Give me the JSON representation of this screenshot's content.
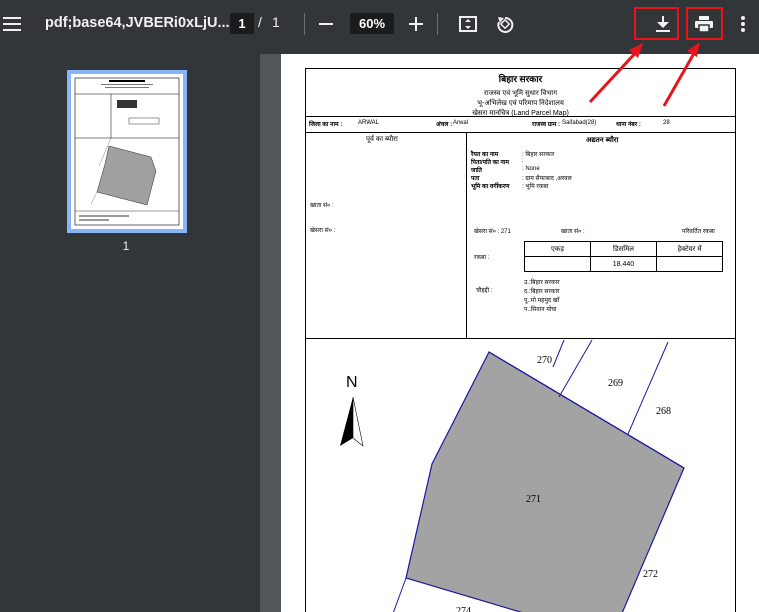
{
  "toolbar": {
    "title": "pdf;base64,JVBERi0xLjU...",
    "page_current": "1",
    "page_sep": "/",
    "page_total": "1",
    "zoom": "60%",
    "icons": [
      "menu-icon",
      "zoom-out-icon",
      "zoom-in-icon",
      "fit-page-icon",
      "rotate-icon",
      "download-icon",
      "print-icon",
      "more-vert-icon"
    ],
    "highlight_color": "#e8141c"
  },
  "sidebar": {
    "thumb_label": "1"
  },
  "doc": {
    "title": "बिहार सरकार",
    "dept": "राजस्व एवं भूमि सुधार विभाग",
    "office": "भू-अभिलेख एवं परिमाप निदेशालय",
    "map_title": "खेसरा मानचित्र (Land Parcel Map)",
    "district_label": "जिला का नाम :",
    "district": "ARWAL",
    "anchal_label": "अंचल :",
    "anchal": "Arwal",
    "village_label": "राजस्व ग्राम :",
    "village": "Saifabad(28)",
    "thana_label": "थाना नंबर :",
    "thana": "28",
    "left_heading": "पूर्व का ब्यौरा",
    "right_heading": "अद्यतन ब्यौरा",
    "owner_rows": [
      {
        "label": "रैयत का नाम",
        "value": ": बिहार सरकार"
      },
      {
        "label": "पिता/पति का नाम",
        "value": ":"
      },
      {
        "label": "जाति",
        "value": ": None"
      },
      {
        "label": "पता",
        "value": ": ग्राम सैफाबाद ,अरवल"
      },
      {
        "label": "भूमि का वर्गीकरण",
        "value": ": भूमि रकबा"
      }
    ],
    "khata_left": "खाता सं० :",
    "khesra_left": "खेसरा सं० :",
    "khesra_right": "खेसरा सं० : 271",
    "khata_right": "खाता सं० :",
    "changed_area": "परिवर्तित रकबा",
    "rakba_label": "रकबा :",
    "area_headers": [
      "एकड़",
      "डिसमिल",
      "हेक्टेयर में"
    ],
    "area_values": [
      "",
      "18.440",
      ""
    ],
    "chauhaddi_label": "चौहद्दी :",
    "boundaries": [
      "उ.:बिहार सरकार",
      "द.:बिहार सरकार",
      "पू.:मो महमुद खाँ",
      "प.:सिवान मोघा"
    ],
    "north": "N",
    "plots": [
      "270",
      "269",
      "268",
      "271",
      "272",
      "274"
    ]
  }
}
